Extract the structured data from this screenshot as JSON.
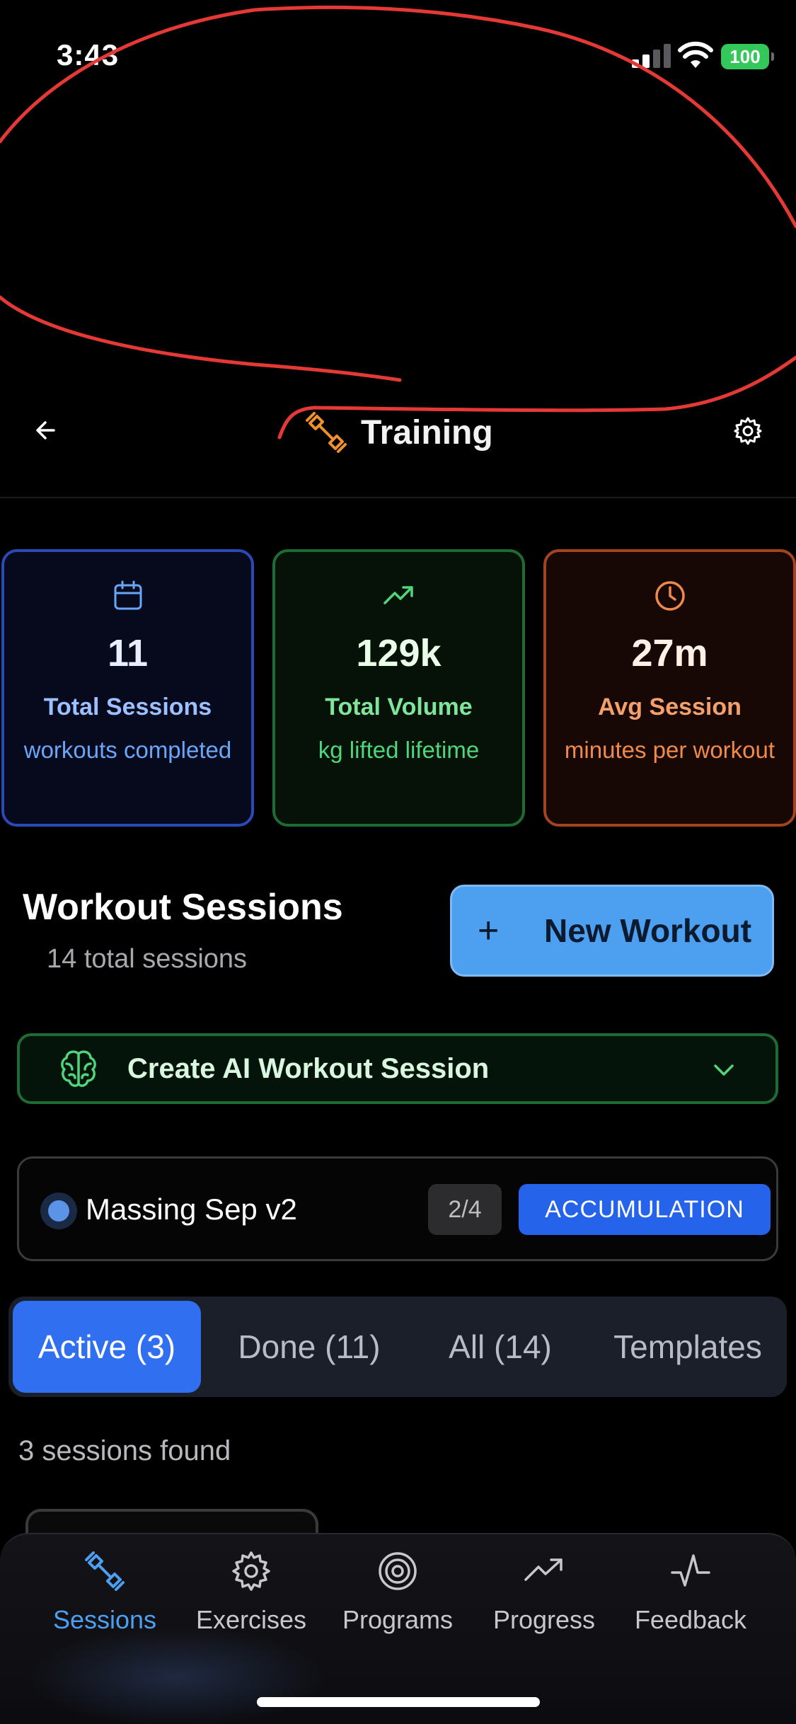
{
  "status_bar": {
    "time": "3:43",
    "battery": "100"
  },
  "header": {
    "title": "Training"
  },
  "stats": [
    {
      "value": "11",
      "label": "Total Sessions",
      "sub": "workouts completed",
      "icon": "calendar-icon",
      "color": "#6aa6f8"
    },
    {
      "value": "129k",
      "label": "Total Volume",
      "sub": "kg lifted lifetime",
      "icon": "trending-up-icon",
      "color": "#4fd57a"
    },
    {
      "value": "27m",
      "label": "Avg Session",
      "sub": "minutes per workout",
      "icon": "clock-icon",
      "color": "#f08a4a"
    }
  ],
  "sessions_section": {
    "title": "Workout Sessions",
    "subtitle": "14 total sessions",
    "new_button": "New Workout"
  },
  "ai_session": {
    "label": "Create AI Workout Session"
  },
  "program": {
    "name": "Massing Sep v2",
    "progress": "2/4",
    "phase": "ACCUMULATION"
  },
  "tabs": [
    {
      "label": "Active (3)",
      "active": true
    },
    {
      "label": "Done (11)",
      "active": false
    },
    {
      "label": "All (14)",
      "active": false
    },
    {
      "label": "Templates",
      "active": false
    }
  ],
  "results": {
    "text": "3 sessions found"
  },
  "nav": [
    {
      "label": "Sessions",
      "icon": "dumbbell-icon",
      "active": true
    },
    {
      "label": "Exercises",
      "icon": "gear-icon",
      "active": false
    },
    {
      "label": "Programs",
      "icon": "target-icon",
      "active": false
    },
    {
      "label": "Progress",
      "icon": "trending-up-icon",
      "active": false
    },
    {
      "label": "Feedback",
      "icon": "activity-icon",
      "active": false
    }
  ],
  "colors": {
    "accent": "#2f6ff0",
    "new_button": "#4da0f0",
    "annotation": "#e53935",
    "header_icon": "#f0902c"
  }
}
